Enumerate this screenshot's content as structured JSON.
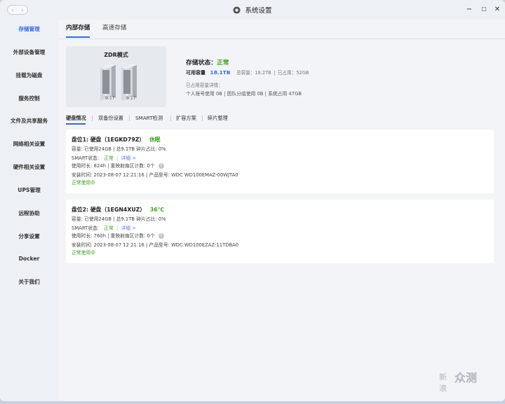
{
  "window": {
    "title": "系统设置",
    "minimize_label": "−",
    "maximize_label": "☐",
    "close_label": "✕"
  },
  "sidebar": {
    "items": [
      {
        "label": "存储管理",
        "active": true
      },
      {
        "label": "外部设备管理",
        "active": false
      },
      {
        "label": "挂载为磁盘",
        "active": false
      },
      {
        "label": "服务控制",
        "active": false
      },
      {
        "label": "文件及共享服务",
        "active": false
      },
      {
        "label": "网络相关设置",
        "active": false
      },
      {
        "label": "硬件相关设置",
        "active": false
      },
      {
        "label": "UPS管理",
        "active": false
      },
      {
        "label": "远程协助",
        "active": false
      },
      {
        "label": "分享设置",
        "active": false
      },
      {
        "label": "Docker",
        "active": false
      },
      {
        "label": "关于我们",
        "active": false
      }
    ]
  },
  "tabs": {
    "internal": "内部存储",
    "highspeed": "高速存储"
  },
  "storage": {
    "mode": "ZDR模式",
    "disk1_size": "9.1T",
    "disk2_size": "9.1T",
    "status_label": "存储状态：",
    "status_value": "正常",
    "available_label": "可用容量",
    "available_value": "18.1TB",
    "total_text": "总容量：18.2TB",
    "used_text": "已占用：52GB",
    "detail_title": "已占用容量详情：",
    "detail_text": "个人账号使用 0B | 团队分组使用 0B | 系统占用 47GB"
  },
  "subtabs": [
    "硬盘情况",
    "双备份设置",
    "SMART检测",
    "扩容方案",
    "碎片整理"
  ],
  "disks": [
    {
      "title": "盘位1:  硬盘（1EGKD79Z）",
      "state": "休眠",
      "capacity": "容量:   已使用24GB | 总9.1TB    碎片占比:   0%",
      "smart_label": "SMART状态:",
      "smart_value": "正常",
      "smart_link": "详细 >",
      "usage": "使用时长:   824h | 重映射扇区计数:   0个",
      "install": "安装时间:   2023-08-07 12:21:16 | 产品型号:   WDC WD100EMAZ-00WJTA0",
      "note": "正常使用中"
    },
    {
      "title": "盘位2:  硬盘（1EGN4XUZ）",
      "state": "36℃",
      "capacity": "容量:   已使用24GB | 总9.1TB    碎片占比:   0%",
      "smart_label": "SMART状态:",
      "smart_value": "正常",
      "smart_link": "详细 >",
      "usage": "使用时长:   760h | 重映射扇区计数:   0个",
      "install": "安装时间:   2023-08-07 12:21:16 | 产品型号:   WDC WD100EZAZ-11TDBA0",
      "note": "正常使用中"
    }
  ],
  "watermark": {
    "left": "新浪",
    "right": "众测"
  },
  "colors": {
    "accent": "#2f6bf0",
    "ok": "#3fa31c",
    "link": "#4f7de8"
  }
}
